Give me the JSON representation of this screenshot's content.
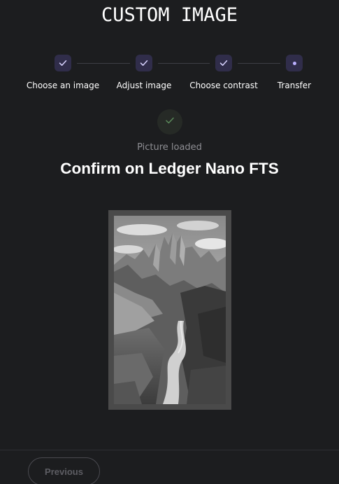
{
  "header": {
    "title": "CUSTOM IMAGE"
  },
  "stepper": {
    "steps": [
      {
        "label": "Choose an image",
        "state": "completed",
        "icon": "check-icon"
      },
      {
        "label": "Adjust image",
        "state": "completed",
        "icon": "check-icon"
      },
      {
        "label": "Choose contrast",
        "state": "completed",
        "icon": "check-icon"
      },
      {
        "label": "Transfer",
        "state": "active",
        "icon": "dot-icon"
      }
    ],
    "colors": {
      "circle_bg": "#302d4a",
      "check": "#d8d3ff",
      "active_dot": "#bbb0ff"
    }
  },
  "status": {
    "icon": "check-icon",
    "text": "Picture loaded",
    "color": "#5b8a5b"
  },
  "main": {
    "heading": "Confirm on Ledger Nano FTS",
    "preview": {
      "description_icon": "mountain-landscape-image"
    }
  },
  "footer": {
    "previous_label": "Previous"
  }
}
